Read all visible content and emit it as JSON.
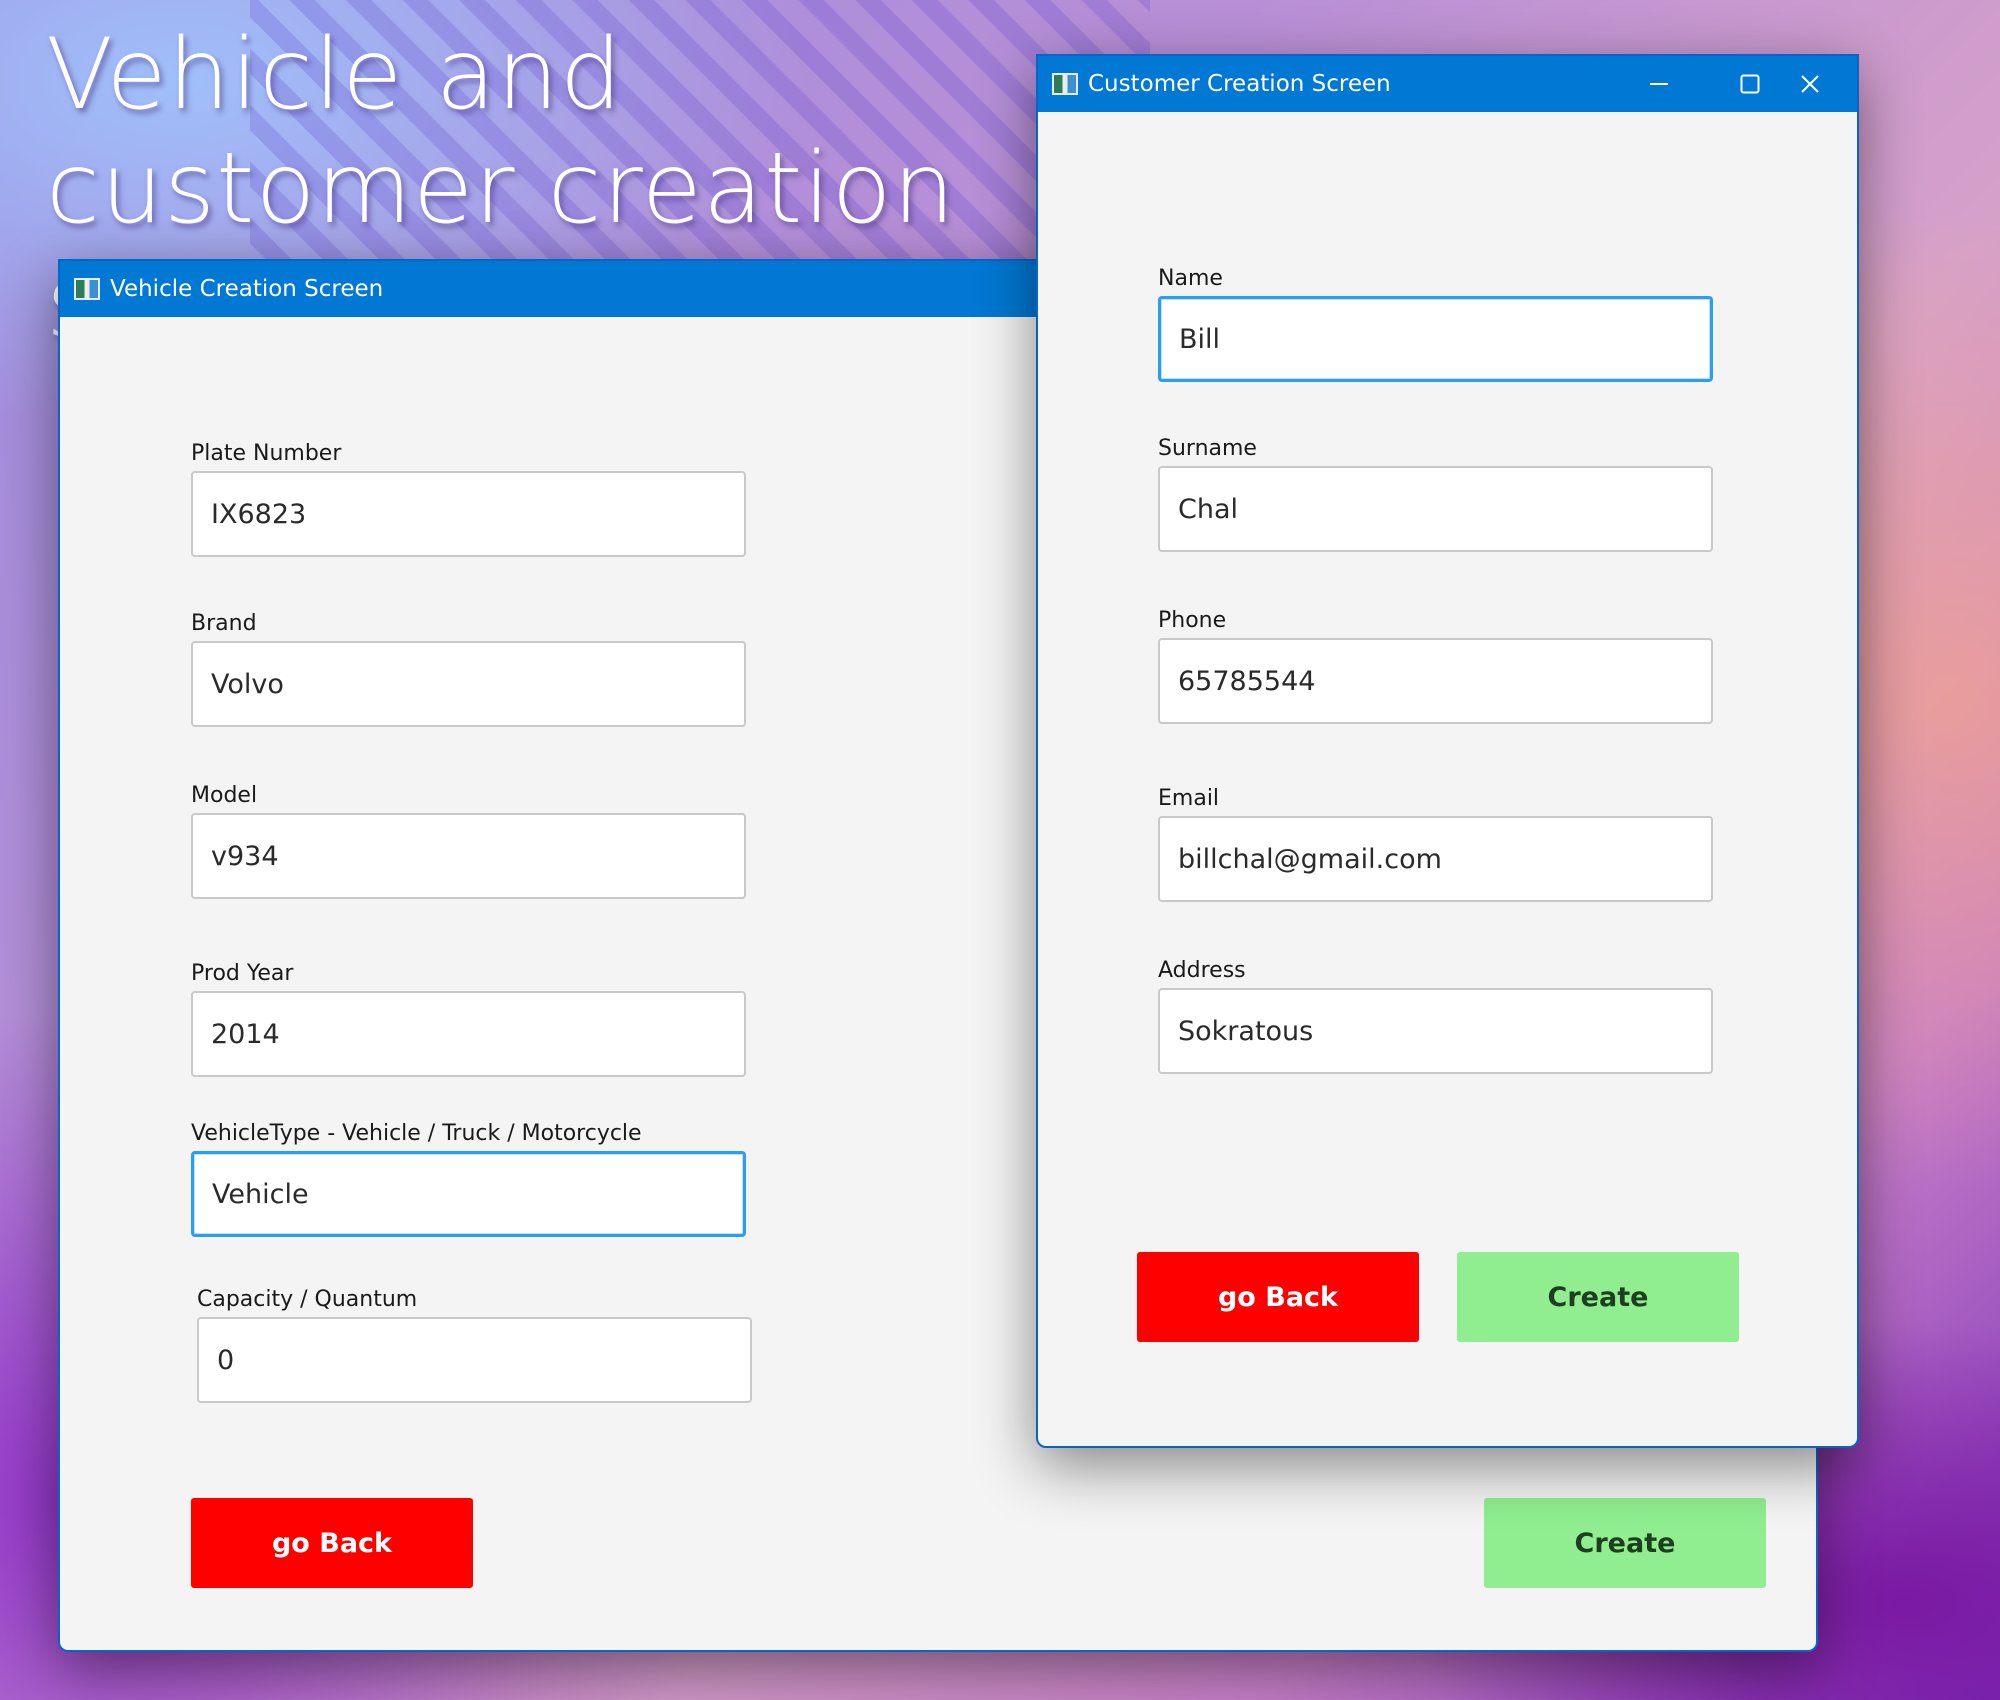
{
  "headline": "Vehicle and customer creation screens",
  "vehicle_window": {
    "title": "Vehicle Creation Screen",
    "fields": [
      {
        "label": "Plate Number",
        "value": "IX6823"
      },
      {
        "label": "Brand",
        "value": "Volvo"
      },
      {
        "label": "Model",
        "value": "v934"
      },
      {
        "label": "Prod Year",
        "value": "2014"
      },
      {
        "label": "VehicleType - Vehicle / Truck / Motorcycle",
        "value": "Vehicle"
      },
      {
        "label": "Capacity / Quantum",
        "value": "0"
      }
    ],
    "back_label": "go Back",
    "create_label": "Create"
  },
  "customer_window": {
    "title": "Customer Creation Screen",
    "fields": [
      {
        "label": "Name",
        "value": "Bill"
      },
      {
        "label": "Surname",
        "value": "Chal"
      },
      {
        "label": "Phone",
        "value": "65785544"
      },
      {
        "label": "Email",
        "value": "billchal@gmail.com"
      },
      {
        "label": "Address",
        "value": "Sokratous"
      }
    ],
    "back_label": "go Back",
    "create_label": "Create"
  },
  "colors": {
    "titlebar": "#0078d4",
    "back_button": "#ff0000",
    "create_button": "#90ee90",
    "focus_border": "#2a9df4"
  }
}
